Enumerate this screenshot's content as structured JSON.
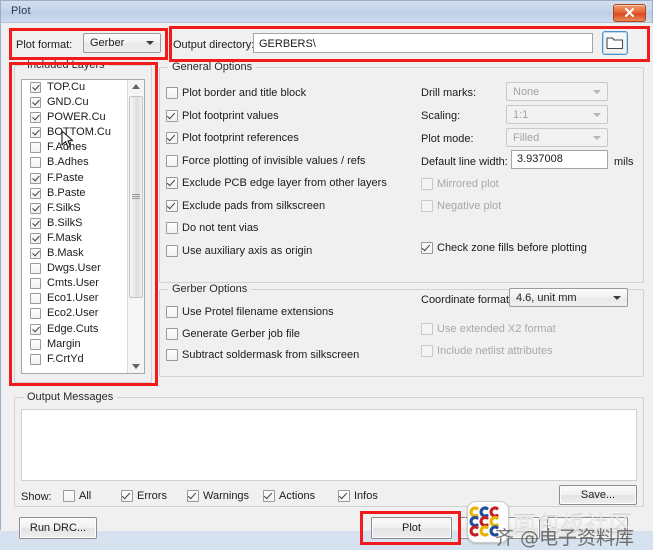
{
  "window": {
    "title": "Plot",
    "close_label": "✕"
  },
  "toolbar": {
    "plot_format_label": "Plot format:",
    "plot_format_value": "Gerber",
    "output_dir_label": "Output directory:",
    "output_dir_value": "GERBERS\\",
    "browse_icon": "folder-icon"
  },
  "included_layers": {
    "title": "Included Layers",
    "layers": [
      {
        "name": "TOP.Cu",
        "checked": true
      },
      {
        "name": "GND.Cu",
        "checked": true
      },
      {
        "name": "POWER.Cu",
        "checked": true
      },
      {
        "name": "BOTTOM.Cu",
        "checked": true
      },
      {
        "name": "F.Adhes",
        "checked": false
      },
      {
        "name": "B.Adhes",
        "checked": false
      },
      {
        "name": "F.Paste",
        "checked": true
      },
      {
        "name": "B.Paste",
        "checked": true
      },
      {
        "name": "F.SilkS",
        "checked": true
      },
      {
        "name": "B.SilkS",
        "checked": true
      },
      {
        "name": "F.Mask",
        "checked": true
      },
      {
        "name": "B.Mask",
        "checked": true
      },
      {
        "name": "Dwgs.User",
        "checked": false
      },
      {
        "name": "Cmts.User",
        "checked": false
      },
      {
        "name": "Eco1.User",
        "checked": false
      },
      {
        "name": "Eco2.User",
        "checked": false
      },
      {
        "name": "Edge.Cuts",
        "checked": true
      },
      {
        "name": "Margin",
        "checked": false
      },
      {
        "name": "F.CrtYd",
        "checked": false
      }
    ]
  },
  "general_options": {
    "title": "General Options",
    "checkboxes": [
      {
        "label": "Plot border and title block",
        "checked": false,
        "disabled": false
      },
      {
        "label": "Plot footprint values",
        "checked": true,
        "disabled": false
      },
      {
        "label": "Plot footprint references",
        "checked": true,
        "disabled": false
      },
      {
        "label": "Force plotting of invisible values / refs",
        "checked": false,
        "disabled": false
      },
      {
        "label": "Exclude PCB edge layer from other layers",
        "checked": true,
        "disabled": false
      },
      {
        "label": "Exclude pads from silkscreen",
        "checked": true,
        "disabled": false
      },
      {
        "label": "Do not tent vias",
        "checked": false,
        "disabled": false
      },
      {
        "label": "Use auxiliary axis as origin",
        "checked": false,
        "disabled": false
      }
    ],
    "drill_marks_label": "Drill marks:",
    "drill_marks_value": "None",
    "scaling_label": "Scaling:",
    "scaling_value": "1:1",
    "plot_mode_label": "Plot mode:",
    "plot_mode_value": "Filled",
    "line_width_label": "Default line width:",
    "line_width_value": "3.937008",
    "line_width_unit": "mils",
    "mirrored_plot": {
      "label": "Mirrored plot",
      "checked": false,
      "disabled": true
    },
    "negative_plot": {
      "label": "Negative plot",
      "checked": false,
      "disabled": true
    },
    "check_zone_fills": {
      "label": "Check zone fills before plotting",
      "checked": true,
      "disabled": false
    }
  },
  "gerber_options": {
    "title": "Gerber Options",
    "left_checkboxes": [
      {
        "label": "Use Protel filename extensions",
        "checked": false,
        "disabled": false
      },
      {
        "label": "Generate Gerber job file",
        "checked": false,
        "disabled": false
      },
      {
        "label": "Subtract soldermask from silkscreen",
        "checked": false,
        "disabled": false
      }
    ],
    "coordinate_format_label": "Coordinate format:",
    "coordinate_format_value": "4.6, unit mm",
    "right_checkboxes": [
      {
        "label": "Use extended X2 format",
        "checked": false,
        "disabled": true
      },
      {
        "label": "Include netlist attributes",
        "checked": false,
        "disabled": true
      }
    ]
  },
  "output_messages": {
    "title": "Output Messages",
    "content": "",
    "show_label": "Show:",
    "filters": [
      {
        "label": "All",
        "checked": false
      },
      {
        "label": "Errors",
        "checked": true
      },
      {
        "label": "Warnings",
        "checked": true
      },
      {
        "label": "Actions",
        "checked": true
      },
      {
        "label": "Infos",
        "checked": true
      }
    ],
    "save_label": "Save..."
  },
  "footer": {
    "run_drc_label": "Run DRC...",
    "plot_label": "Plot",
    "secondary_label": ""
  },
  "watermark": {
    "text_top": "面包板社区",
    "text_bottom": "齐 @电子资料库"
  },
  "annotations": {
    "highlight_color": "#f21b1b",
    "boxes": [
      "plot-format-highlight",
      "output-directory-highlight",
      "included-layers-highlight",
      "plot-button-highlight"
    ]
  }
}
